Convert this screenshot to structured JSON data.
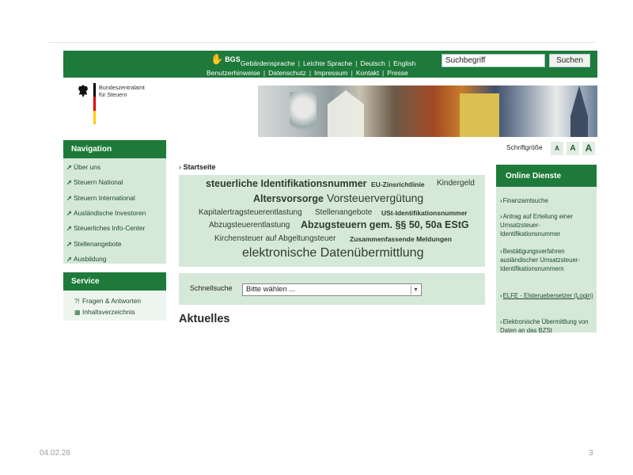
{
  "topbar": {
    "logo_text": "BGS",
    "links_row1": [
      "Gebärdensprache",
      "Leichte Sprache",
      "Deutsch",
      "English"
    ],
    "links_row2": [
      "Benutzerhinweise",
      "Datenschutz",
      "Impressum",
      "Kontakt",
      "Presse"
    ],
    "search_value": "Suchbegriff",
    "search_button": "Suchen"
  },
  "header": {
    "org_line1": "Bundeszentralamt",
    "org_line2": "für Steuern",
    "flag_colors": [
      "#000000",
      "#dd0000",
      "#ffcc00"
    ]
  },
  "navigation": {
    "title": "Navigation",
    "items": [
      {
        "label": "Über uns"
      },
      {
        "label": "Steuern National"
      },
      {
        "label": "Steuern International"
      },
      {
        "label": "Ausländische Investoren"
      },
      {
        "label": "Steuerliches Info-Center"
      },
      {
        "label": "Stellenangebote"
      },
      {
        "label": "Ausbildung"
      }
    ]
  },
  "service": {
    "title": "Service",
    "items": [
      {
        "label": "Fragen & Antworten",
        "icon": "qa-icon"
      },
      {
        "label": "Inhaltsverzeichnis",
        "icon": "sitemap-icon"
      }
    ]
  },
  "fontsize": {
    "label": "Schriftgröße",
    "buttons": [
      "A",
      "A",
      "A"
    ]
  },
  "breadcrumb": "Startseite",
  "tagcloud": [
    "steuerliche Identifikationsnummer",
    "EU-Zinsrichtlinie",
    "Kindergeld",
    "Altersvorsorge",
    "Vorsteuervergütung",
    "Kapitalertragsteuerentlastung",
    "Stellenangebote",
    "USt-Identifikationsnummer",
    "Abzugsteuerentlastung",
    "Abzugsteuern gem. §§ 50, 50a EStG",
    "Kirchensteuer auf Abgeltungsteuer",
    "Zusammenfassende Meldungen",
    "elektronische Datenübermittlung"
  ],
  "quicksearch": {
    "label": "Schnellsuche",
    "selected": "Bitte wählen ..."
  },
  "main": {
    "section_title": "Aktuelles"
  },
  "online_dienste": {
    "title": "Online Dienste",
    "items": [
      {
        "label": "Finanzamtsuche"
      },
      {
        "label": "Antrag auf Erteilung einer Umsatzsteuer-Identifikationsnummer"
      },
      {
        "label": "Bestätigungsverfahren ausländischer Umsatzsteuer-Identifikationsnummern"
      },
      {
        "label": "ELFE - Elsteruebersetzer (Login)"
      },
      {
        "label": "Elektronische Übermittlung von Daten an das BZSt"
      }
    ]
  },
  "footer": {
    "date": "04.02.26",
    "page": "3"
  },
  "colors": {
    "brand_green": "#1e7a3a",
    "panel_green": "#d6e8d8"
  }
}
